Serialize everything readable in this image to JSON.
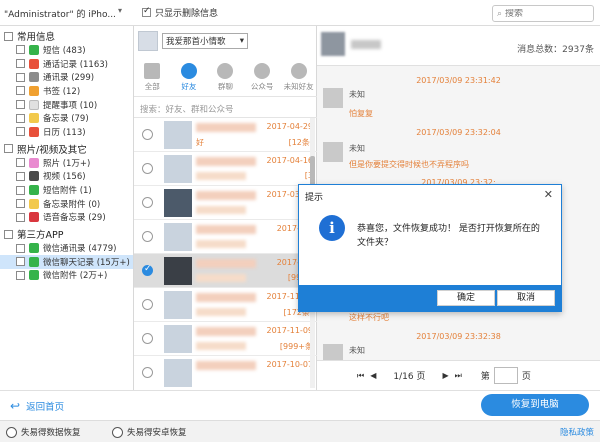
{
  "topbar": {
    "device_title": "\"Administrator\" 的 iPho...",
    "only_deleted_label": "只显示删除信息",
    "search_placeholder": "搜索"
  },
  "sidebar": {
    "groups": [
      {
        "label": "常用信息",
        "items": [
          {
            "label": "短信 (483)",
            "icon": "sms-icon",
            "color": "#35b34a"
          },
          {
            "label": "通话记录 (1163)",
            "icon": "call-log-icon",
            "color": "#e8503a"
          },
          {
            "label": "通讯录 (299)",
            "icon": "contacts-icon",
            "color": "#8c8c8c"
          },
          {
            "label": "书签 (12)",
            "icon": "bookmark-icon",
            "color": "#f0a030"
          },
          {
            "label": "提醒事项 (10)",
            "icon": "reminder-icon",
            "color": "#e0e0e0"
          },
          {
            "label": "备忘录 (79)",
            "icon": "notes-icon",
            "color": "#f2c94c"
          },
          {
            "label": "日历 (113)",
            "icon": "calendar-icon",
            "color": "#e8503a"
          }
        ]
      },
      {
        "label": "照片/视频及其它",
        "items": [
          {
            "label": "照片 (1万+)",
            "icon": "photos-icon",
            "color": "#e98ad0"
          },
          {
            "label": "视频 (156)",
            "icon": "video-icon",
            "color": "#4a4a4a"
          },
          {
            "label": "短信附件 (1)",
            "icon": "sms-attachment-icon",
            "color": "#35b34a"
          },
          {
            "label": "备忘录附件 (0)",
            "icon": "notes-attachment-icon",
            "color": "#f2c94c"
          },
          {
            "label": "语音备忘录 (29)",
            "icon": "voice-memo-icon",
            "color": "#d9363e"
          }
        ]
      },
      {
        "label": "第三方APP",
        "items": [
          {
            "label": "微信通讯录 (4779)",
            "icon": "wechat-contacts-icon",
            "color": "#35b34a"
          },
          {
            "label": "微信聊天记录 (15万+)",
            "icon": "wechat-chat-icon",
            "color": "#35b34a",
            "selected": true
          },
          {
            "label": "微信附件 (2万+)",
            "icon": "wechat-attachment-icon",
            "color": "#35b34a"
          }
        ]
      }
    ]
  },
  "middle": {
    "account_select": "我爱那首小情歌",
    "tabs": [
      {
        "label": "全部",
        "icon": "grid-icon"
      },
      {
        "label": "好友",
        "icon": "friend-icon",
        "active": true
      },
      {
        "label": "群聊",
        "icon": "group-chat-icon"
      },
      {
        "label": "公众号",
        "icon": "official-account-icon"
      },
      {
        "label": "未知好友",
        "icon": "unknown-friend-icon"
      }
    ],
    "search_placeholder": "搜索：好友、群和公众号",
    "contacts": [
      {
        "date": "2017-04-29",
        "count": "[12条]",
        "preview": "好",
        "checked": false
      },
      {
        "date": "2017-04-16",
        "count": "[3",
        "checked": false
      },
      {
        "date": "2017-03-02",
        "count": "[3",
        "checked": false
      },
      {
        "date": "2017-07-",
        "count": "[",
        "checked": false
      },
      {
        "date": "2017-11-",
        "count": "[999+",
        "checked": true,
        "selected": true
      },
      {
        "date": "2017-11-03",
        "count": "[172条]",
        "checked": false
      },
      {
        "date": "2017-11-09",
        "count": "[999+条",
        "checked": false
      },
      {
        "date": "2017-10-07",
        "count": "",
        "checked": false
      }
    ]
  },
  "chat": {
    "total_label": "消息总数：2937条",
    "messages": [
      {
        "time": "2017/03/09 23:31:42",
        "sender": "未知",
        "text": "怕复复"
      },
      {
        "time": "2017/03/09 23:32:04",
        "sender": "未知",
        "text": "但是你要提交得时候也不弄程序吗"
      },
      {
        "time": "2017/03/09 23:32:",
        "sender": "",
        "text": ""
      },
      {
        "time": "",
        "sender": "",
        "text": "这样不行吧"
      },
      {
        "time": "2017/03/09 23:32:38",
        "sender": "未知",
        "text": ""
      }
    ],
    "pager": {
      "page_text": "1/16 页",
      "goto_label": "第",
      "page_unit": "页"
    }
  },
  "dialog": {
    "title": "提示",
    "message": "恭喜您，文件恢复成功！ 是否打开恢复所在的文件夹？",
    "ok_label": "确定",
    "cancel_label": "取消"
  },
  "bottom": {
    "back_label": "返回首页",
    "recover_label": "恢复到电脑"
  },
  "footer": {
    "item1": "失易得数据恢复",
    "item2": "失易得安卓恢复",
    "privacy": "隐私政策"
  }
}
